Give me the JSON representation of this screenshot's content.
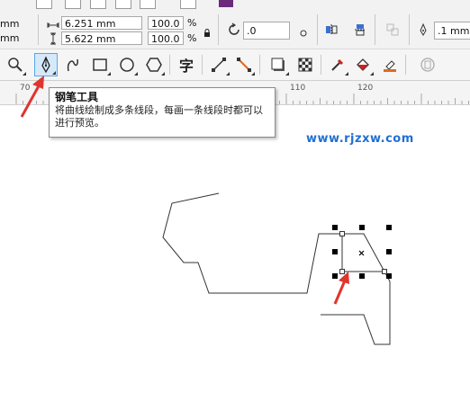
{
  "property_bar": {
    "unit_top": "mm",
    "unit_bottom": "mm",
    "width_value": "6.251 mm",
    "height_value": "5.622 mm",
    "scale_x": "100.0",
    "scale_y": "100.0",
    "percent_symbol_1": "%",
    "percent_symbol_2": "%",
    "rotation_value": ".0",
    "outline_width": ".1 mm"
  },
  "toolbox": {
    "text_tool_glyph": "字",
    "tools": [
      "zoom-tool",
      "pen-tool",
      "bezier-tool",
      "rectangle-tool",
      "ellipse-tool",
      "polygon-tool",
      "text-tool",
      "connector-tool",
      "dimension-tool",
      "drop-shadow-tool",
      "transparency-tool",
      "eyedropper-tool",
      "interactive-fill-tool",
      "smart-fill-tool",
      "outline-tool"
    ],
    "active_tool": "pen-tool"
  },
  "ruler": {
    "ticks": [
      "70",
      "110",
      "120"
    ]
  },
  "tooltip": {
    "title": "钢笔工具",
    "body": "将曲线绘制成多条线段，每画一条线段时都可以进行预览。"
  },
  "watermark": "www.rjzxw.com",
  "colors": {
    "accent": "#e0342e",
    "watermark": "#1f6fd6",
    "active_tool_bg": "#d6e9fb"
  }
}
